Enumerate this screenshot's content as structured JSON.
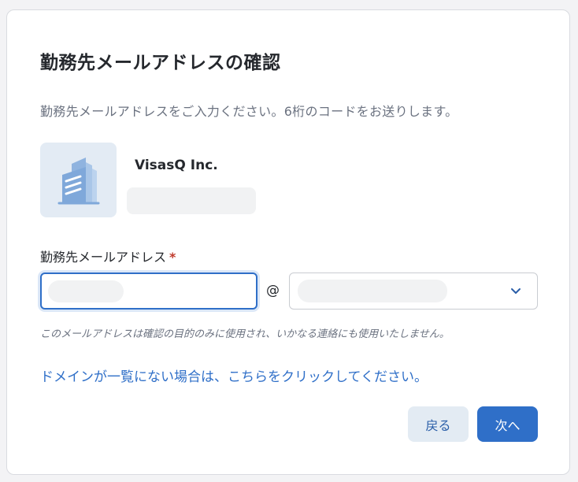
{
  "dialog": {
    "title": "勤務先メールアドレスの確認",
    "description": "勤務先メールアドレスをご入力ください。6桁のコードをお送りします。"
  },
  "company": {
    "name": "VisasQ Inc.",
    "logo_icon": "building-icon"
  },
  "email_field": {
    "label": "勤務先メールアドレス",
    "required_mark": "*",
    "local_part_value": "",
    "at_symbol": "@",
    "domain_value": "",
    "dropdown_icon": "chevron-down-icon",
    "note": "このメールアドレスは確認の目的のみに使用され、いかなる連絡にも使用いたしません。"
  },
  "domain_link": {
    "label": "ドメインが一覧にない場合は、こちらをクリックしてください。"
  },
  "actions": {
    "back_label": "戻る",
    "next_label": "次へ"
  },
  "colors": {
    "primary": "#2f6fc8",
    "secondary_bg": "#e3ebf3",
    "logo_bg": "#e3ebf4",
    "logo_fg": "#7fa8da"
  }
}
